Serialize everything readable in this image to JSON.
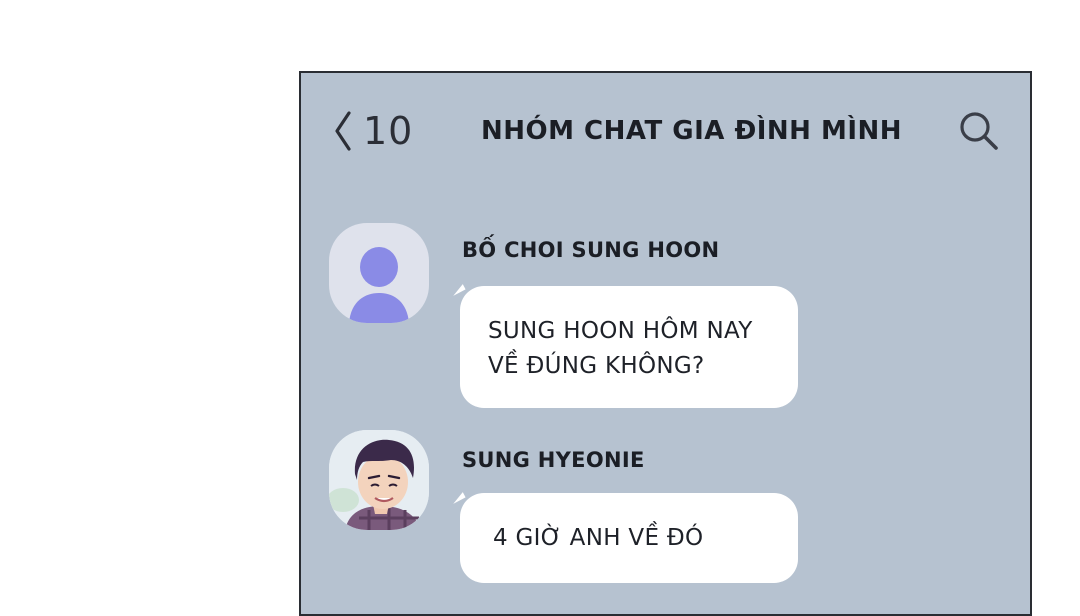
{
  "header": {
    "back_count": "10",
    "title": "NHÓM CHAT GIA ĐÌNH MÌNH",
    "back_icon": "chevron-left-icon",
    "search_icon": "search-icon"
  },
  "messages": [
    {
      "sender": "BỐ CHOI SUNG HOON",
      "avatar": "default-person-avatar",
      "lines": [
        "SUNG HOON HÔM NAY",
        "VỀ ĐÚNG KHÔNG?"
      ]
    },
    {
      "sender": "SUNG HYEONIE",
      "avatar": "character-portrait-avatar",
      "lines": [
        "4 GIỜ ANH VỀ ĐÓ"
      ]
    }
  ],
  "colors": {
    "background": "#b6c2d0",
    "bubble": "#ffffff",
    "default_avatar_bg": "#dfe2ec",
    "default_avatar_figure": "#8a8be6"
  }
}
